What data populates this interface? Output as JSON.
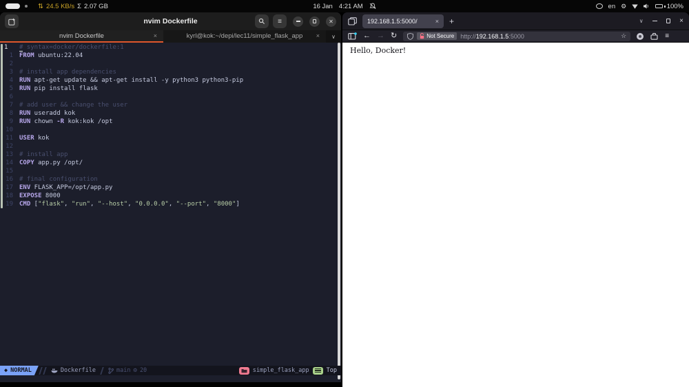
{
  "topbar": {
    "net_arrows": "⇅",
    "net_speed": "24.5 KB/s",
    "sigma": "Σ",
    "memory": "2.07 GB",
    "date": "16 Jan",
    "time": "4:21 AM",
    "keyboard_layout": "en",
    "battery_percent": "100%"
  },
  "terminal": {
    "window_title": "nvim Dockerfile",
    "tabs": [
      {
        "label": "nvim Dockerfile",
        "close": "×",
        "active": true
      },
      {
        "label": "kyrl@kok:~/depi/lec11/simple_flask_app",
        "close": "×",
        "active": false
      }
    ],
    "editor": {
      "lines": [
        {
          "n": "1",
          "cur": true,
          "tokens": [
            [
              "cm",
              "# syntax=docker/dockerfile:1"
            ]
          ]
        },
        {
          "n": "1",
          "tokens": [
            [
              "kw",
              "FROM"
            ],
            [
              "tx",
              " ubuntu:22.04"
            ]
          ]
        },
        {
          "n": "2",
          "tokens": []
        },
        {
          "n": "3",
          "tokens": [
            [
              "cm",
              "# install app dependencies"
            ]
          ]
        },
        {
          "n": "4",
          "tokens": [
            [
              "kw",
              "RUN"
            ],
            [
              "tx",
              " apt-get update && apt-get install -y python3 python3-pip"
            ]
          ]
        },
        {
          "n": "5",
          "tokens": [
            [
              "kw",
              "RUN"
            ],
            [
              "tx",
              " pip install flask"
            ]
          ]
        },
        {
          "n": "6",
          "tokens": []
        },
        {
          "n": "7",
          "tokens": [
            [
              "cm",
              "# add user && change the user"
            ]
          ]
        },
        {
          "n": "8",
          "tokens": [
            [
              "kw",
              "RUN"
            ],
            [
              "tx",
              " useradd kok"
            ]
          ]
        },
        {
          "n": "9",
          "tokens": [
            [
              "kw",
              "RUN"
            ],
            [
              "tx",
              " chown "
            ],
            [
              "kw",
              "-R"
            ],
            [
              "tx",
              " kok:kok /opt"
            ]
          ]
        },
        {
          "n": "10",
          "tokens": []
        },
        {
          "n": "11",
          "tokens": [
            [
              "kw",
              "USER"
            ],
            [
              "tx",
              " kok"
            ]
          ]
        },
        {
          "n": "12",
          "tokens": []
        },
        {
          "n": "13",
          "tokens": [
            [
              "cm",
              "# install app"
            ]
          ]
        },
        {
          "n": "14",
          "tokens": [
            [
              "kw",
              "COPY"
            ],
            [
              "tx",
              " app.py /opt/"
            ]
          ]
        },
        {
          "n": "15",
          "tokens": []
        },
        {
          "n": "16",
          "tokens": [
            [
              "cm",
              "# final configuration"
            ]
          ]
        },
        {
          "n": "17",
          "tokens": [
            [
              "kw",
              "ENV"
            ],
            [
              "tx",
              " FLASK_APP=/opt/app.py"
            ]
          ]
        },
        {
          "n": "18",
          "tokens": [
            [
              "kw",
              "EXPOSE"
            ],
            [
              "tx",
              " 8000"
            ]
          ]
        },
        {
          "n": "19",
          "tokens": [
            [
              "kw",
              "CMD"
            ],
            [
              "tx",
              " ["
            ],
            [
              "st",
              "\"flask\""
            ],
            [
              "tx",
              ", "
            ],
            [
              "st",
              "\"run\""
            ],
            [
              "tx",
              ", "
            ],
            [
              "st",
              "\"--host\""
            ],
            [
              "tx",
              ", "
            ],
            [
              "st",
              "\"0.0.0.0\""
            ],
            [
              "tx",
              ", "
            ],
            [
              "st",
              "\"--port\""
            ],
            [
              "tx",
              ", "
            ],
            [
              "st",
              "\"8000\""
            ],
            [
              "tx",
              "]"
            ]
          ]
        }
      ]
    },
    "statusline": {
      "mode": "NORMAL",
      "filetype": "Dockerfile",
      "branch": "main",
      "change_count": "20",
      "project": "simple_flask_app",
      "position": "Top"
    }
  },
  "browser": {
    "tab_title": "192.168.1.5:5000/",
    "tab_close": "×",
    "new_tab": "+",
    "security_label": "Not Secure",
    "url_scheme": "http://",
    "url_host": "192.168.1.5",
    "url_port": ":5000",
    "page_text": "Hello, Docker!"
  },
  "colors": {
    "tab_accent_orange": "#e0562c",
    "mode_blue": "#7aa2f7",
    "project_pink": "#ee7a90",
    "position_green": "#a9d18a",
    "net_yellow": "#c9a227",
    "keyword_purple": "#b8a8ec",
    "string_green": "#b9cfa8",
    "comment_gray": "#494f6e",
    "security_lock_red": "#ff7286",
    "sidebar_dot_blue": "#35d2f5"
  }
}
